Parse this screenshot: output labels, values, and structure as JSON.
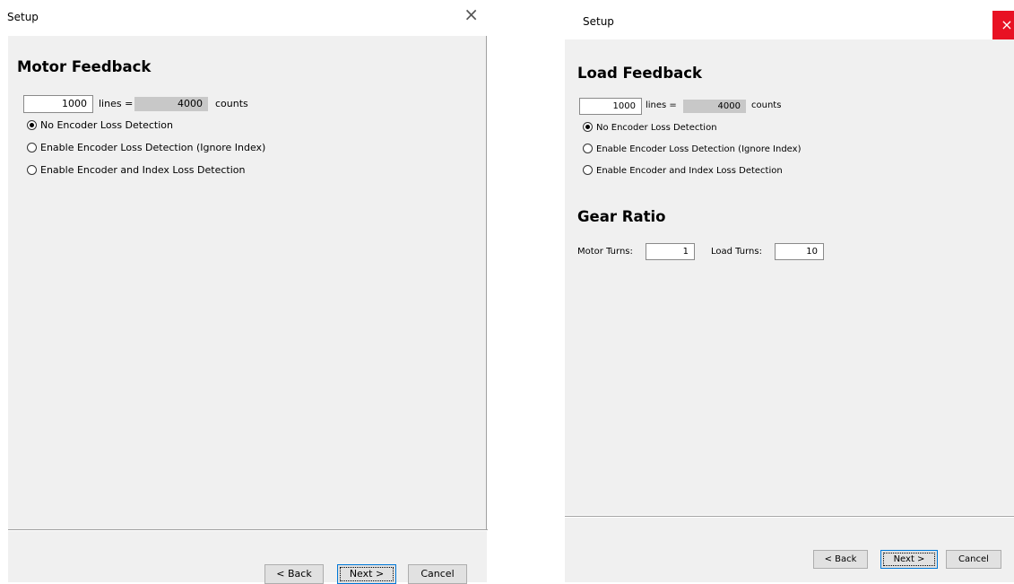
{
  "motor_window": {
    "title": "Setup",
    "close_glyph": "×",
    "heading": "Motor Feedback",
    "lines_value": "1000",
    "lines_label": "lines =",
    "counts_value": "4000",
    "counts_label": "counts",
    "radios": [
      {
        "label": "No Encoder Loss Detection",
        "selected": true
      },
      {
        "label": "Enable Encoder Loss Detection (Ignore Index)",
        "selected": false
      },
      {
        "label": "Enable Encoder and Index Loss Detection",
        "selected": false
      }
    ],
    "buttons": {
      "back": "< Back",
      "next": "Next >",
      "cancel": "Cancel"
    }
  },
  "load_window": {
    "title": "Setup",
    "close_glyph": "×",
    "heading": "Load Feedback",
    "lines_value": "1000",
    "lines_label": "lines =",
    "counts_value": "4000",
    "counts_label": "counts",
    "radios": [
      {
        "label": "No Encoder Loss Detection",
        "selected": true
      },
      {
        "label": "Enable Encoder Loss Detection (Ignore Index)",
        "selected": false
      },
      {
        "label": "Enable Encoder and Index Loss Detection",
        "selected": false
      }
    ],
    "gear_heading": "Gear Ratio",
    "motor_turns_label": "Motor Turns:",
    "motor_turns_value": "1",
    "load_turns_label": "Load Turns:",
    "load_turns_value": "10",
    "buttons": {
      "back": "< Back",
      "next": "Next >",
      "cancel": "Cancel"
    }
  }
}
